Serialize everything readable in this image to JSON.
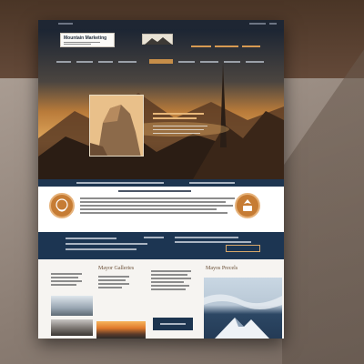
{
  "brand": {
    "logo_text": "Mountain Marketing"
  },
  "sections": {
    "gallery_heading": "Mayor Galleries",
    "right_heading": "Mayos Precels"
  },
  "colors": {
    "accent_orange": "#c67c34",
    "navy": "#1c3552",
    "topbar": "#1e2633"
  },
  "icons": {
    "left_feature_icon": "spiral-hand-icon",
    "right_feature_icon": "hand-leaf-icon"
  }
}
